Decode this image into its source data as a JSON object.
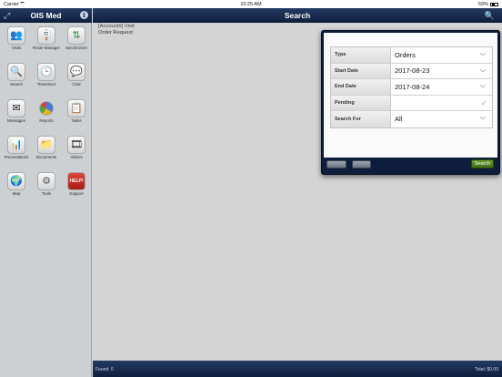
{
  "status_bar": {
    "carrier": "Carrier",
    "time": "10:25 AM",
    "battery": "59%"
  },
  "sidebar": {
    "title": "OIS Med",
    "items": [
      {
        "label": "Visits",
        "icon": "people-icon"
      },
      {
        "label": "Route Manager",
        "icon": "signpost-icon"
      },
      {
        "label": "Synchronize",
        "icon": "sync-icon"
      },
      {
        "label": "Search",
        "icon": "magnifier-icon"
      },
      {
        "label": "Timesheet",
        "icon": "clock-icon"
      },
      {
        "label": "Chat",
        "icon": "chat-icon"
      },
      {
        "label": "Messages",
        "icon": "envelope-icon"
      },
      {
        "label": "Reports",
        "icon": "pie-chart-icon"
      },
      {
        "label": "Tasks",
        "icon": "checklist-icon"
      },
      {
        "label": "Presentations",
        "icon": "easel-icon"
      },
      {
        "label": "Documents",
        "icon": "folder-icon"
      },
      {
        "label": "Videos",
        "icon": "film-icon"
      },
      {
        "label": "Map",
        "icon": "globe-icon"
      },
      {
        "label": "Tools",
        "icon": "gear-icon"
      },
      {
        "label": "Support",
        "icon": "help-icon"
      }
    ]
  },
  "main": {
    "title": "Search",
    "row": {
      "title": "[Account#] Visit",
      "subtitle": "Order Request"
    },
    "footer": {
      "found": "Found: 0",
      "total": "Total: $0.00"
    }
  },
  "popover": {
    "fields": [
      {
        "label": "Type",
        "value": "Orders"
      },
      {
        "label": "Start Date",
        "value": "2017-08-23"
      },
      {
        "label": "End Date",
        "value": "2017-08-24"
      },
      {
        "label": "Pending",
        "value": ""
      },
      {
        "label": "Search For",
        "value": "All"
      }
    ],
    "search_label": "Search"
  }
}
